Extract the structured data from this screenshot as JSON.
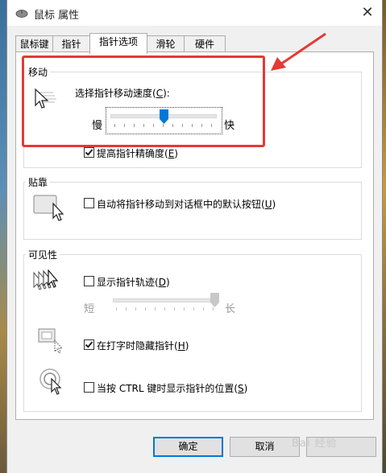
{
  "window": {
    "title": "鼠标 属性",
    "close_glyph": "✕"
  },
  "tabs": [
    {
      "label": "鼠标键"
    },
    {
      "label": "指针"
    },
    {
      "label": "指针选项",
      "active": true
    },
    {
      "label": "滑轮"
    },
    {
      "label": "硬件"
    }
  ],
  "motion": {
    "group_label": "移动",
    "speed_label_prefix": "选择指针移动速度(",
    "speed_label_key": "C",
    "speed_label_suffix": "):",
    "slow_label": "慢",
    "fast_label": "快",
    "speed_level": 0.5,
    "precision_prefix": "提高指针精确度(",
    "precision_key": "E",
    "precision_suffix": ")",
    "precision_checked": true
  },
  "snap": {
    "group_label": "贴靠",
    "snap_prefix": "自动将指针移动到对话框中的默认按钮(",
    "snap_key": "U",
    "snap_suffix": ")",
    "snap_checked": false
  },
  "visibility": {
    "group_label": "可见性",
    "trails_prefix": "显示指针轨迹(",
    "trails_key": "D",
    "trails_suffix": ")",
    "trails_checked": false,
    "short_label": "短",
    "long_label": "长",
    "trail_level": 1.0,
    "hide_prefix": "在打字时隐藏指针(",
    "hide_key": "H",
    "hide_suffix": ")",
    "hide_checked": true,
    "ctrl_prefix": "当按 CTRL 键时显示指针的位置(",
    "ctrl_key": "S",
    "ctrl_suffix": ")",
    "ctrl_checked": false
  },
  "buttons": {
    "ok": "确定",
    "cancel": "取消"
  },
  "watermark": "Bai 经验",
  "colors": {
    "annotation": "#e53935",
    "accent": "#0078d7"
  }
}
